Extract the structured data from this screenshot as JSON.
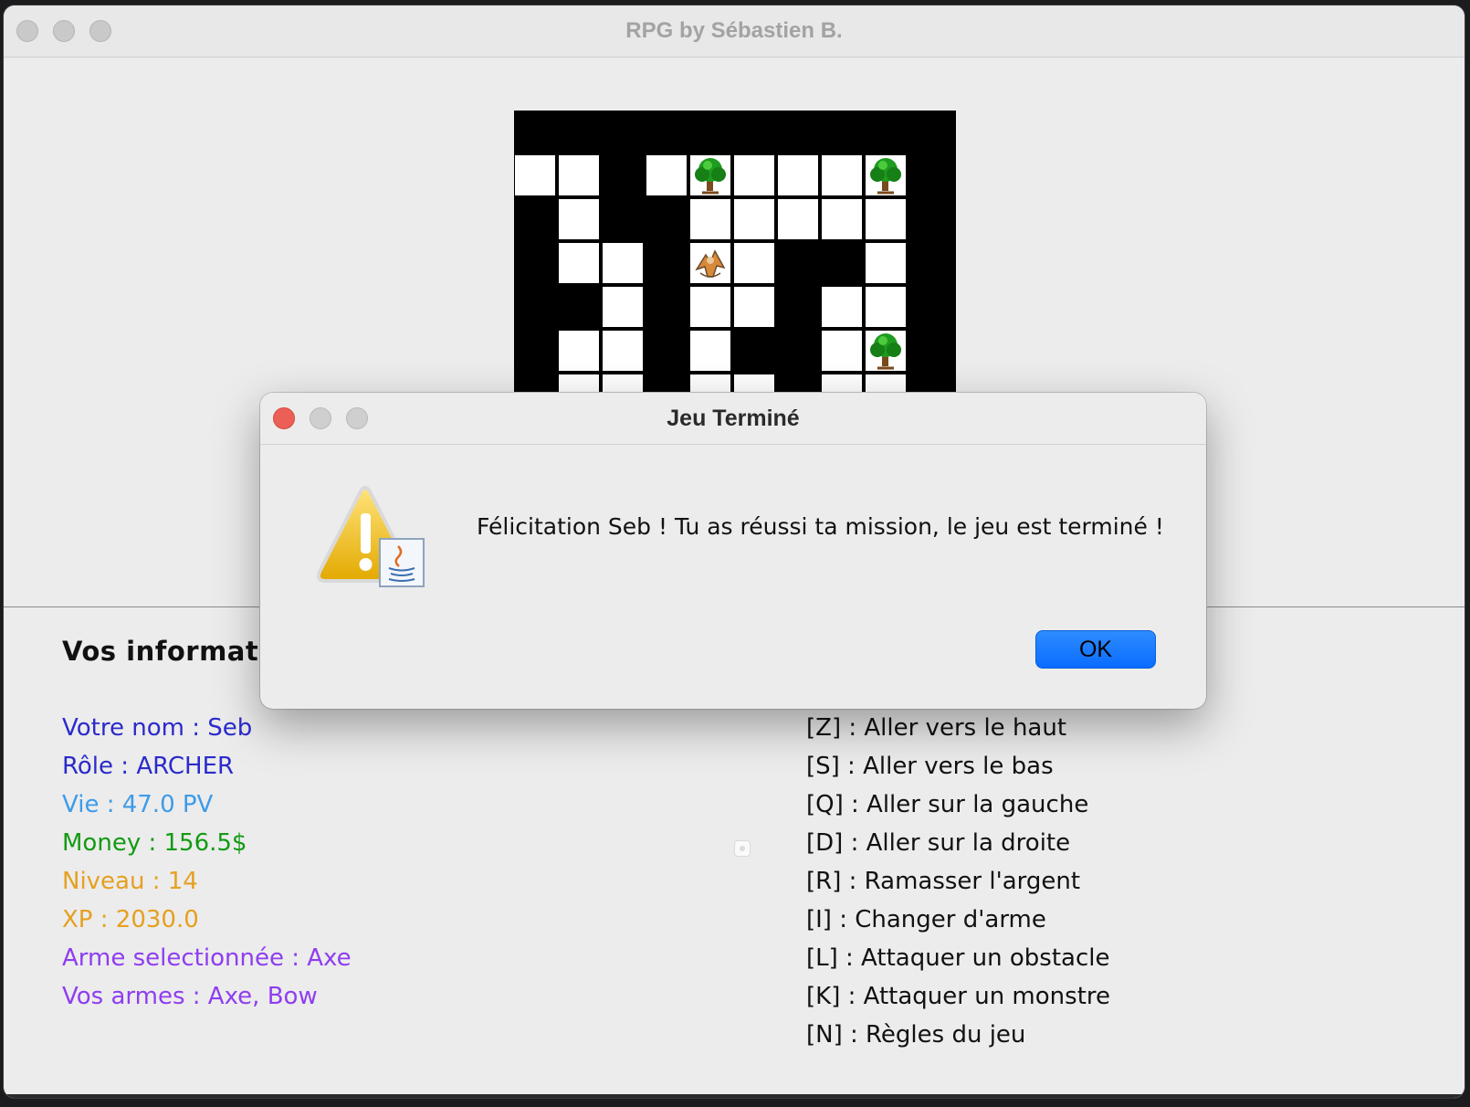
{
  "window": {
    "title": "RPG by Sébastien B."
  },
  "board": {
    "grid_rows": [
      "##########",
      "WW#WTWWWT#",
      "#W##WWWWW#",
      "#WW#DW##W#",
      "##W#WW#WW#",
      "#WW#W##WT#",
      "#WW#WW#WW#"
    ],
    "legend": {
      "#": "wall",
      "W": "floor",
      "T": "tree",
      "D": "monster"
    }
  },
  "info": {
    "heading": "Vos informatio",
    "stats": [
      {
        "text": "Votre nom : Seb",
        "color": "#2b2bcc"
      },
      {
        "text": "Rôle : ARCHER",
        "color": "#2b2bcc"
      },
      {
        "text": "Vie : 47.0 PV",
        "color": "#3d9be9"
      },
      {
        "text": "Money : 156.5$",
        "color": "#139a13"
      },
      {
        "text": "Niveau : 14",
        "color": "#e6a020"
      },
      {
        "text": "XP : 2030.0",
        "color": "#e6a020"
      },
      {
        "text": "Arme selectionnée : Axe",
        "color": "#8f3df0"
      },
      {
        "text": "Vos armes : Axe, Bow",
        "color": "#8f3df0"
      }
    ]
  },
  "controls": [
    "[Z] : Aller vers le haut",
    "[S] : Aller vers le bas",
    "[Q] : Aller sur la gauche",
    "[D] : Aller sur la droite",
    "[R] : Ramasser l'argent",
    "[I] : Changer d'arme",
    "[L] : Attaquer un obstacle",
    "[K] : Attaquer un monstre",
    "[N] : Règles du jeu"
  ],
  "dialog": {
    "title": "Jeu Terminé",
    "message": "Félicitation Seb ! Tu as réussi ta mission, le jeu est terminé !",
    "ok_label": "OK",
    "icon": "warning-java-icon"
  },
  "colors": {
    "accent": "#0a6cff",
    "close_red": "#ec5f57"
  }
}
